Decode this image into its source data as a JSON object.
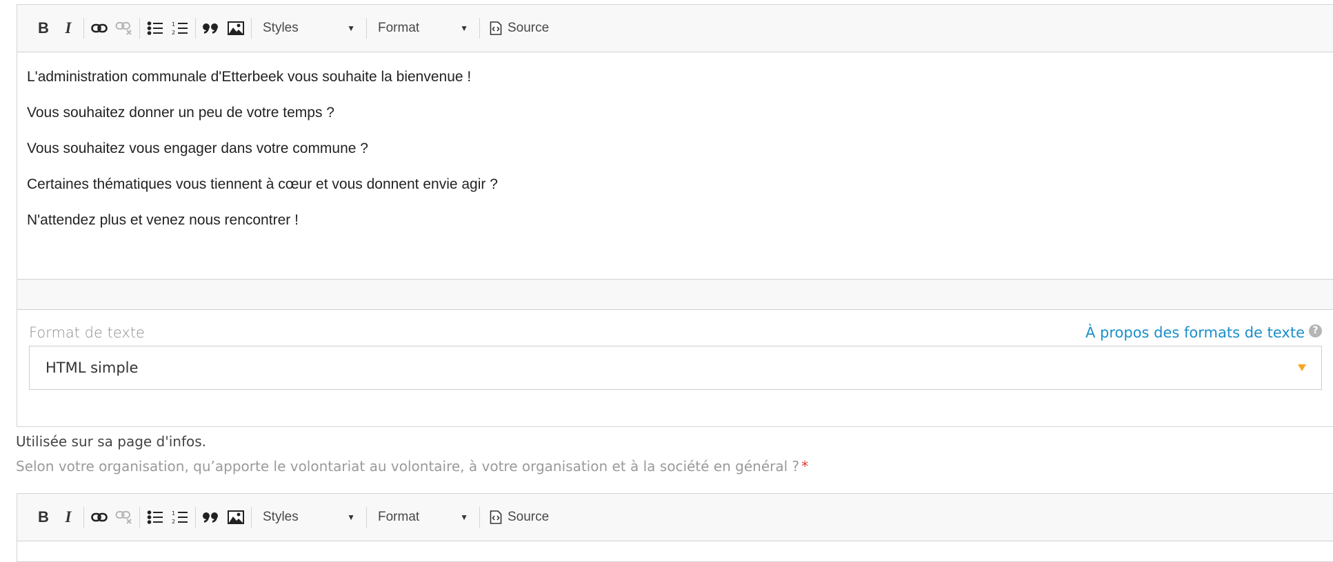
{
  "toolbar": {
    "bold_label": "B",
    "italic_label": "I",
    "styles_label": "Styles",
    "format_label": "Format",
    "source_label": "Source"
  },
  "editor1": {
    "paragraphs": [
      "L'administration communale d'Etterbeek vous souhaite la bienvenue  !",
      "Vous souhaitez donner un peu de votre temps ?",
      "Vous souhaitez vous engager dans votre commune ?",
      "Certaines thématiques vous tiennent à cœur et vous donnent envie agir ?",
      "N'attendez plus et venez nous rencontrer !"
    ]
  },
  "text_format": {
    "label": "Format de texte",
    "help_link": "À propos des formats de texte",
    "selected": "HTML simple"
  },
  "field_description": "Utilisée sur sa page d'infos.",
  "next_field": {
    "label": "Selon votre organisation, qu’apporte le volontariat au volontaire, à votre organisation et à la société en général ?",
    "required_mark": "*"
  },
  "colors": {
    "link": "#1a8fc9",
    "dropdown_arrow": "#f5a623",
    "required": "#e03a3a"
  }
}
